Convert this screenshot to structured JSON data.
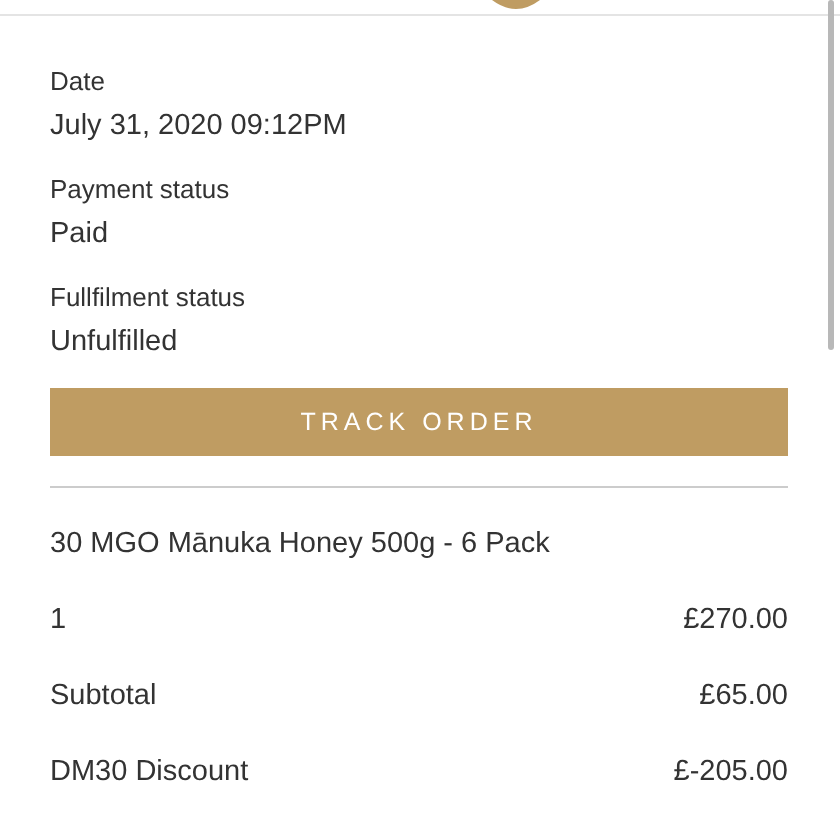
{
  "details": [
    {
      "label": "Date",
      "value": "July 31, 2020 09:12PM"
    },
    {
      "label": "Payment status",
      "value": "Paid"
    },
    {
      "label": "Fullfilment status",
      "value": "Unfulfilled"
    }
  ],
  "track_button": "TRACK ORDER",
  "product": "30 MGO Mānuka Honey 500g - 6 Pack",
  "lines": [
    {
      "label": "1",
      "amount": "£270.00"
    },
    {
      "label": "Subtotal",
      "amount": "£65.00"
    },
    {
      "label": "DM30 Discount",
      "amount": "£-205.00"
    }
  ]
}
